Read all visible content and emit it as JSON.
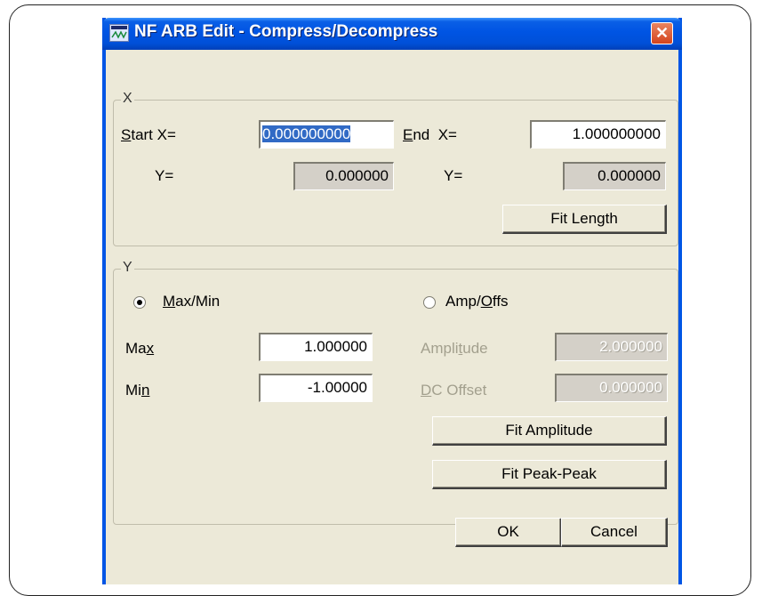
{
  "window": {
    "title": "NF ARB Edit - Compress/Decompress",
    "close_label": "✕"
  },
  "x_group": {
    "label": "X",
    "start_label": "Start X=",
    "start_value": "0.000000000",
    "end_label": "End  X=",
    "end_value": "1.000000000",
    "y_label_left": "Y=",
    "y_value_left": "0.000000",
    "y_label_right": "Y=",
    "y_value_right": "0.000000",
    "fit_length": "Fit Length"
  },
  "y_group": {
    "label": "Y",
    "maxmin_label": "Max/Min",
    "ampoffs_label": "Amp/Offs",
    "max_label": "Max",
    "max_value": "1.000000",
    "min_label": "Min",
    "min_value": "-1.00000",
    "amplitude_label": "Amplitude",
    "amplitude_value": "2.000000",
    "dcoffset_label": "DC Offset",
    "dcoffset_value": "0.000000",
    "fit_amplitude": "Fit Amplitude",
    "fit_peak": "Fit Peak-Peak",
    "selected_mode": "Max/Min"
  },
  "footer": {
    "ok": "OK",
    "cancel": "Cancel"
  }
}
